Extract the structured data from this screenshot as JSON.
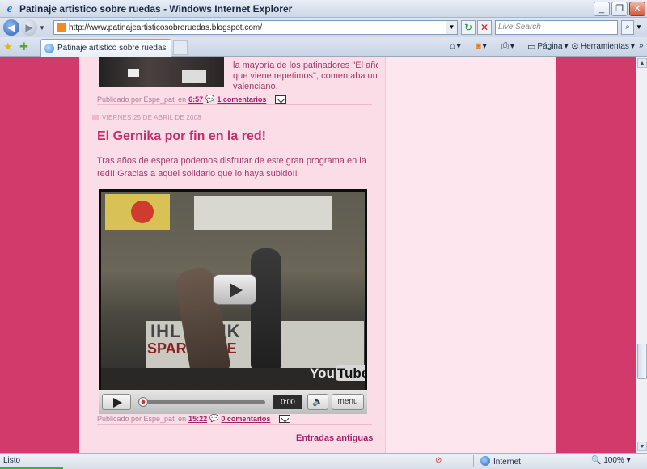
{
  "window": {
    "title": "Patinaje artistico sobre ruedas - Windows Internet Explorer"
  },
  "address": {
    "url": "http://www.patinajeartisticosobreruedas.blogspot.com/"
  },
  "search": {
    "placeholder": "Live Search"
  },
  "tab": {
    "label": "Patinaje artistico sobre ruedas"
  },
  "commands": {
    "page_label": "Página",
    "tools_label": "Herramientas"
  },
  "previous_post": {
    "text_lines": [
      "la mayoría de los patinadores \"El año",
      "que viene repetimos\", comentaba un",
      "valenciano."
    ],
    "footer": {
      "prefix": "Publicado por Espe_pati en",
      "time": "6:57",
      "comments": "1 comentarios"
    }
  },
  "post": {
    "date": "VIERNES 25 DE ABRIL DE 2008",
    "title": "El Gernika por fin en la red!",
    "body": "Tras años de espera podemos disfrutar de este gran programa en la red!! Gracias a aquel solidario que lo haya subido!!",
    "footer": {
      "prefix": "Publicado por Espe_pati en",
      "time": "15:22",
      "comments": "0 comentarios"
    }
  },
  "video": {
    "time": "0:00",
    "menu_label": "menu",
    "logo_you": "You",
    "logo_tube": "Tube",
    "hoarding_line1": "IHL SANK",
    "hoarding_line2": "SPARKASSE"
  },
  "older_posts_link": "Entradas antiguas",
  "status": {
    "left": "Listo",
    "zone": "Internet",
    "zoom": "100%"
  },
  "colors": {
    "page_bg": "#d23a6c",
    "content_bg": "#fbdde8",
    "title": "#c2306a",
    "link": "#a3206a"
  }
}
